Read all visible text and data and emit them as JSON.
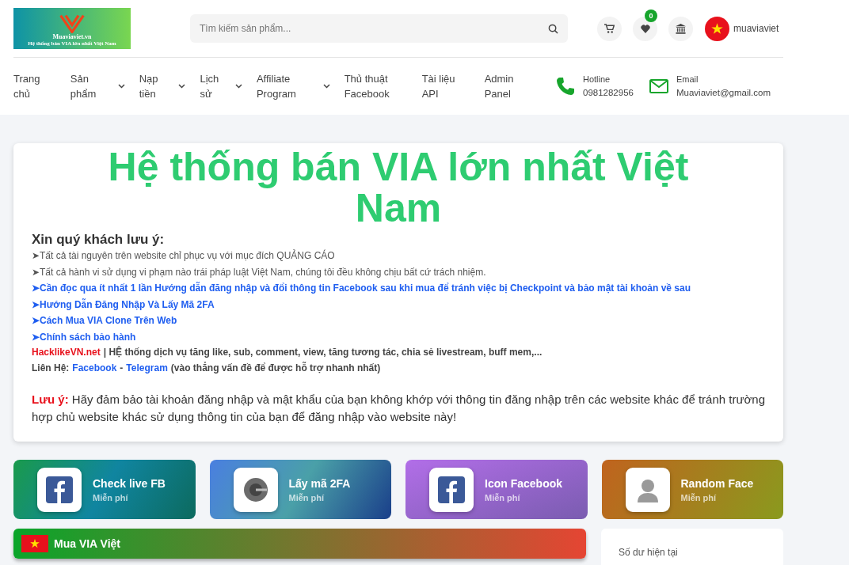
{
  "header": {
    "logo": {
      "name": "Muaviaviet.vn",
      "tagline": "Hệ thống bán VIA lớn nhất Việt Nam"
    },
    "search": {
      "placeholder": "Tìm kiếm sản phẩm..."
    },
    "wishlist_count": "0",
    "username": "muaviaviet"
  },
  "nav": [
    {
      "label": "Trang chủ",
      "dropdown": false
    },
    {
      "label": "Sản phẩm",
      "dropdown": true
    },
    {
      "label": "Nạp tiền",
      "dropdown": true
    },
    {
      "label": "Lịch sử",
      "dropdown": true
    },
    {
      "label": "Affiliate Program",
      "dropdown": true
    },
    {
      "label": "Thủ thuật Facebook",
      "dropdown": false
    },
    {
      "label": "Tài liệu API",
      "dropdown": false
    },
    {
      "label": "Admin Panel",
      "dropdown": false
    }
  ],
  "contacts": [
    {
      "kind": "phone",
      "label": "Hotline",
      "value": "0981282956"
    },
    {
      "kind": "email",
      "label": "Email",
      "value": "Muaviaviet@gmail.com"
    }
  ],
  "notice": {
    "title": "Hệ thống bán VIA lớn nhất Việt Nam",
    "heading": "Xin quý khách lưu ý:",
    "lines": [
      {
        "kind": "note",
        "text": "➤Tất cả tài nguyên trên website chỉ phục vụ với mục đích QUẢNG CÁO"
      },
      {
        "kind": "note",
        "text": "➤Tất cả hành vi sử dụng vi phạm nào trái pháp luật Việt Nam, chúng tôi đều không chịu bất cứ trách nhiệm."
      },
      {
        "kind": "link",
        "text": "➤Cần đọc qua ít nhất 1 lần  Hướng dẫn đăng nhập và đổi thông tin Facebook sau khi mua để tránh việc bị Checkpoint và bảo mật tài khoản về sau"
      },
      {
        "kind": "link",
        "text": "➤Hướng Dẫn Đăng Nhập Và Lấy Mã 2FA"
      },
      {
        "kind": "link",
        "text": "➤Cách Mua VIA Clone Trên Web"
      },
      {
        "kind": "link",
        "text": "➤Chính sách bảo hành"
      }
    ],
    "partner": {
      "name": "HacklikeVN.net",
      "text": "| HỆ thống dịch vụ tăng like, sub, comment, view, tăng tương tác, chia sẻ livestream, buff mem,..."
    },
    "contact": {
      "label": "Liên Hệ:",
      "links": [
        "Facebook",
        "Telegram"
      ],
      "separator": "-",
      "suffix": "(vào thẳng vấn đề để được hỗ trợ nhanh nhất)"
    },
    "warning": {
      "label": "Lưu ý:",
      "text": "Hãy đảm bảo tài khoản đăng nhập và mật khẩu của bạn không khớp với thông tin đăng nhập trên các website khác để tránh trường hợp chủ website khác sử dụng thông tin của bạn để đăng nhập vào website này!"
    }
  },
  "tools": [
    {
      "kind": "facebook",
      "name": "Check live FB",
      "price": "Miễn phí"
    },
    {
      "kind": "authenticator",
      "name": "Lấy mã 2FA",
      "price": "Miễn phí"
    },
    {
      "kind": "facebook",
      "name": "Icon Facebook",
      "price": "Miễn phí"
    },
    {
      "kind": "face",
      "name": "Random Face",
      "price": "Miễn phí"
    }
  ],
  "banner": {
    "label": "Mua VIA Việt"
  },
  "balance": {
    "label": "Số dư hiện tại"
  }
}
